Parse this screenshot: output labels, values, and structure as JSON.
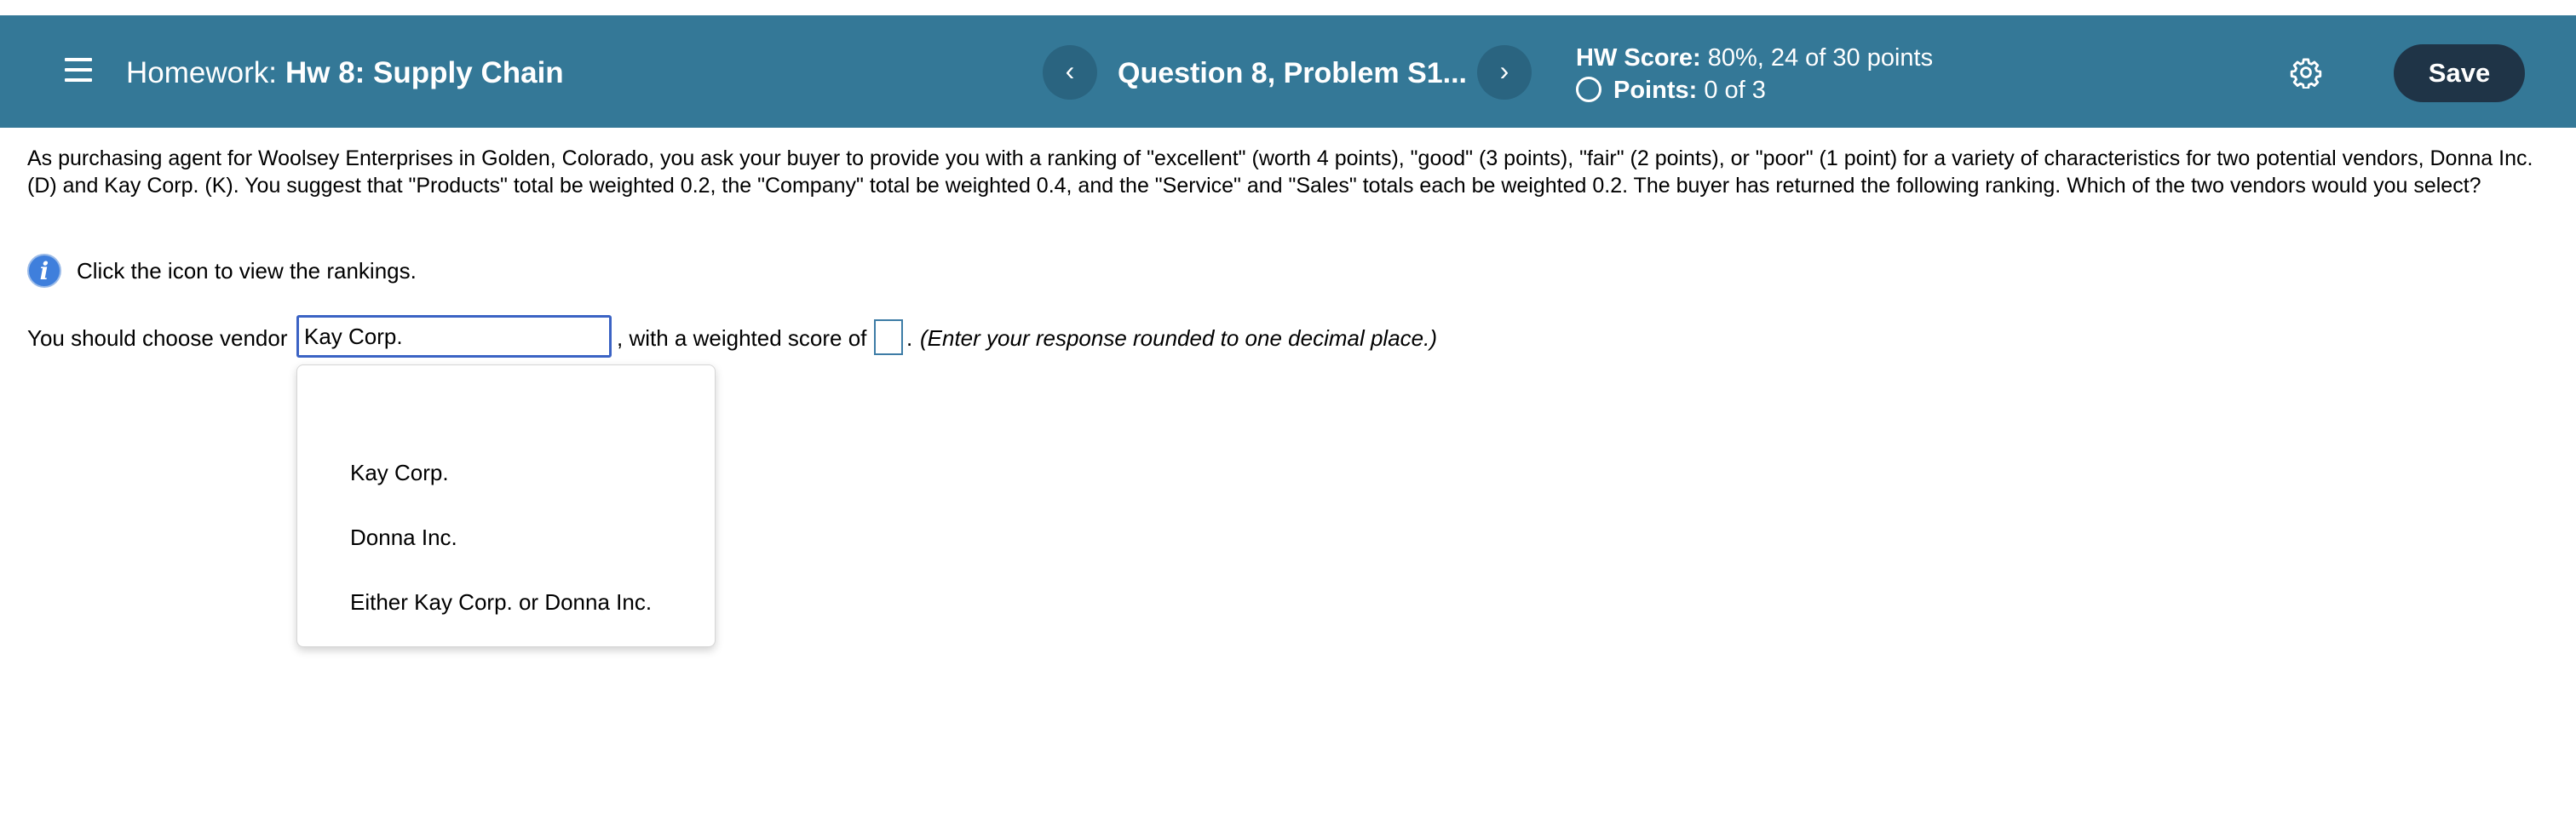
{
  "header": {
    "title_label": "Homework:",
    "title_name": "Hw 8: Supply Chain",
    "prev_icon": "‹",
    "next_icon": "›",
    "question_title": "Question 8, Problem S1...",
    "score_label": "HW Score:",
    "score_value": "80%, 24 of 30 points",
    "points_label": "Points:",
    "points_value": "0 of 3",
    "save_label": "Save",
    "colors": {
      "bar": "#347897",
      "save": "#1f3447",
      "nav": "#2a6480"
    }
  },
  "question": {
    "text": "As purchasing agent for Woolsey Enterprises in Golden, Colorado, you ask your buyer to provide you with a ranking of \"excellent\" (worth 4 points), \"good\" (3 points), \"fair\" (2 points), or \"poor\"  (1 point) for a variety of characteristics for two potential vendors, Donna Inc. (D) and Kay Corp. (K). You suggest that \"Products\" total be weighted 0.2, the \"Company\" total be weighted 0.4, and the \"Service\" and \"Sales\" totals each be weighted 0.2. The buyer has returned the following ranking. Which of the two vendors would you select?",
    "info_text": "Click the icon to view the rankings."
  },
  "answer": {
    "prefix": "You should choose vendor",
    "selected_vendor": "Kay Corp.",
    "middle": ", with a weighted score of",
    "score_value": "",
    "period": ".",
    "hint": "(Enter your response rounded to one decimal place.)"
  },
  "dropdown": {
    "options": [
      "Kay Corp.",
      "Donna Inc.",
      "Either Kay Corp. or Donna Inc."
    ]
  }
}
